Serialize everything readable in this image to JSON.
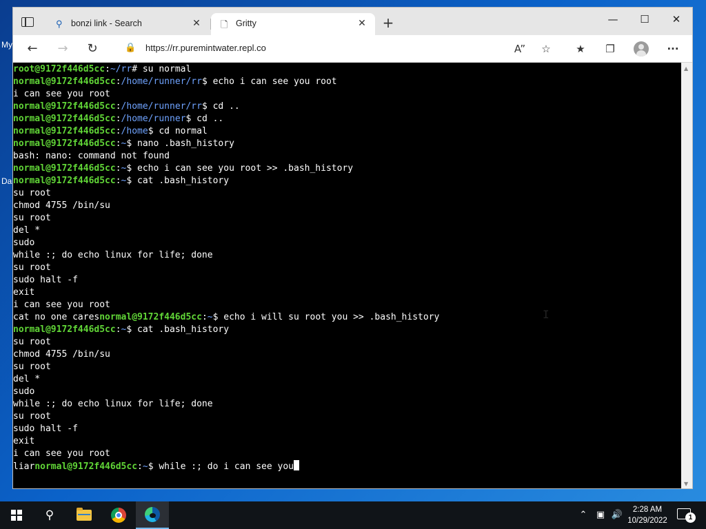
{
  "desktop": {
    "label_top": "My",
    "label_mid": "Da"
  },
  "browser": {
    "tabs": [
      {
        "title": "bonzi link - Search",
        "icon": "search-icon",
        "active": false
      },
      {
        "title": "Gritty",
        "icon": "page-icon",
        "active": true
      }
    ],
    "address_bar": {
      "url": "https://rr.puremintwater.repl.co"
    }
  },
  "terminal": {
    "lines": [
      [
        [
          "u",
          "root@9172f446d5cc"
        ],
        [
          "t",
          ":"
        ],
        [
          "p",
          "~/rr"
        ],
        [
          "t",
          "# su normal"
        ]
      ],
      [
        [
          "u",
          "normal@9172f446d5cc"
        ],
        [
          "t",
          ":"
        ],
        [
          "p",
          "/home/runner/rr"
        ],
        [
          "t",
          "$ echo i can see you root"
        ]
      ],
      [
        [
          "t",
          "i can see you root"
        ]
      ],
      [
        [
          "u",
          "normal@9172f446d5cc"
        ],
        [
          "t",
          ":"
        ],
        [
          "p",
          "/home/runner/rr"
        ],
        [
          "t",
          "$ cd .."
        ]
      ],
      [
        [
          "u",
          "normal@9172f446d5cc"
        ],
        [
          "t",
          ":"
        ],
        [
          "p",
          "/home/runner"
        ],
        [
          "t",
          "$ cd .."
        ]
      ],
      [
        [
          "u",
          "normal@9172f446d5cc"
        ],
        [
          "t",
          ":"
        ],
        [
          "p",
          "/home"
        ],
        [
          "t",
          "$ cd normal"
        ]
      ],
      [
        [
          "u",
          "normal@9172f446d5cc"
        ],
        [
          "t",
          ":"
        ],
        [
          "p",
          "~"
        ],
        [
          "t",
          "$ nano .bash_history"
        ]
      ],
      [
        [
          "t",
          "bash: nano: command not found"
        ]
      ],
      [
        [
          "u",
          "normal@9172f446d5cc"
        ],
        [
          "t",
          ":"
        ],
        [
          "p",
          "~"
        ],
        [
          "t",
          "$ echo i can see you root >> .bash_history"
        ]
      ],
      [
        [
          "u",
          "normal@9172f446d5cc"
        ],
        [
          "t",
          ":"
        ],
        [
          "p",
          "~"
        ],
        [
          "t",
          "$ cat .bash_history"
        ]
      ],
      [
        [
          "t",
          "su root"
        ]
      ],
      [
        [
          "t",
          "chmod 4755 /bin/su"
        ]
      ],
      [
        [
          "t",
          "su root"
        ]
      ],
      [
        [
          "t",
          "del *"
        ]
      ],
      [
        [
          "t",
          "sudo"
        ]
      ],
      [
        [
          "t",
          "while :; do echo linux for life; done"
        ]
      ],
      [
        [
          "t",
          "su root"
        ]
      ],
      [
        [
          "t",
          "sudo halt -f"
        ]
      ],
      [
        [
          "t",
          "exit"
        ]
      ],
      [
        [
          "t",
          "i can see you root"
        ]
      ],
      [
        [
          "t",
          "cat no one cares"
        ],
        [
          "u",
          "normal@9172f446d5cc"
        ],
        [
          "t",
          ":"
        ],
        [
          "p",
          "~"
        ],
        [
          "t",
          "$ echo i will su root you >> .bash_history"
        ]
      ],
      [
        [
          "u",
          "normal@9172f446d5cc"
        ],
        [
          "t",
          ":"
        ],
        [
          "p",
          "~"
        ],
        [
          "t",
          "$ cat .bash_history"
        ]
      ],
      [
        [
          "t",
          "su root"
        ]
      ],
      [
        [
          "t",
          "chmod 4755 /bin/su"
        ]
      ],
      [
        [
          "t",
          "su root"
        ]
      ],
      [
        [
          "t",
          "del *"
        ]
      ],
      [
        [
          "t",
          "sudo"
        ]
      ],
      [
        [
          "t",
          "while :; do echo linux for life; done"
        ]
      ],
      [
        [
          "t",
          "su root"
        ]
      ],
      [
        [
          "t",
          "sudo halt -f"
        ]
      ],
      [
        [
          "t",
          "exit"
        ]
      ],
      [
        [
          "t",
          "i can see you root"
        ]
      ],
      [
        [
          "t",
          "liar"
        ],
        [
          "u",
          "normal@9172f446d5cc"
        ],
        [
          "t",
          ":"
        ],
        [
          "p",
          "~"
        ],
        [
          "t",
          "$ while :; do i can see you"
        ]
      ]
    ],
    "colors": {
      "user": "#61d637",
      "path": "#6fa3ff",
      "text": "#ffffff",
      "background": "#000000"
    }
  },
  "taskbar": {
    "icons": [
      "windows-start-icon",
      "search-icon",
      "file-explorer-icon",
      "chrome-icon",
      "edge-icon"
    ],
    "clock": {
      "time": "2:28 AM",
      "date": "10/29/2022"
    },
    "notification_count": "1"
  }
}
